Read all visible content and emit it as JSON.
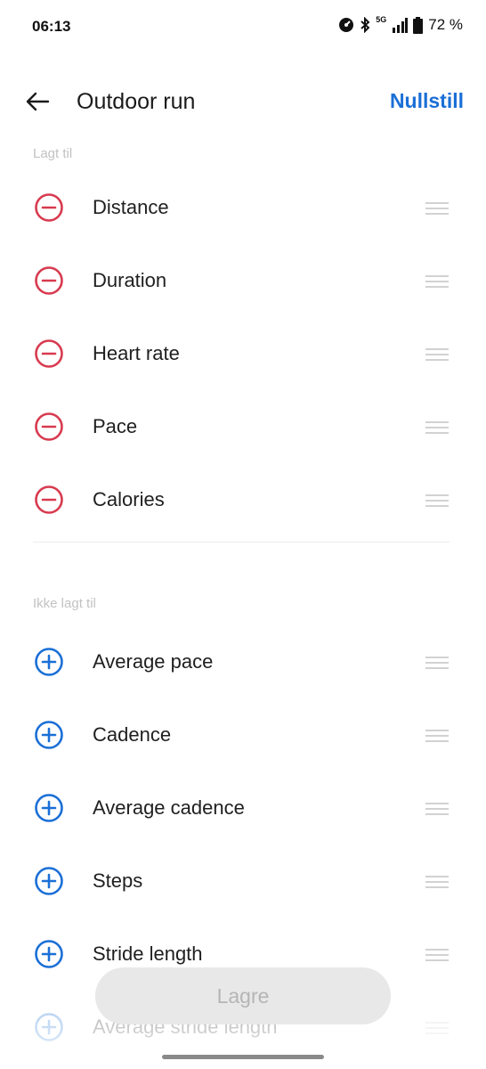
{
  "status_bar": {
    "time": "06:13",
    "network": "5G",
    "battery": "72 %"
  },
  "header": {
    "title": "Outdoor run",
    "reset_label": "Nullstill"
  },
  "added": {
    "label": "Lagt til",
    "items": [
      {
        "label": "Distance"
      },
      {
        "label": "Duration"
      },
      {
        "label": "Heart rate"
      },
      {
        "label": "Pace"
      },
      {
        "label": "Calories"
      }
    ]
  },
  "not_added": {
    "label": "Ikke lagt til",
    "items": [
      {
        "label": "Average pace"
      },
      {
        "label": "Cadence"
      },
      {
        "label": "Average cadence"
      },
      {
        "label": "Steps"
      },
      {
        "label": "Stride length"
      },
      {
        "label": "Average stride length"
      }
    ]
  },
  "footer": {
    "save_label": "Lagre"
  },
  "colors": {
    "remove": "#d83a4f",
    "add": "#1a6fd6",
    "accent": "#1a6fd6"
  }
}
